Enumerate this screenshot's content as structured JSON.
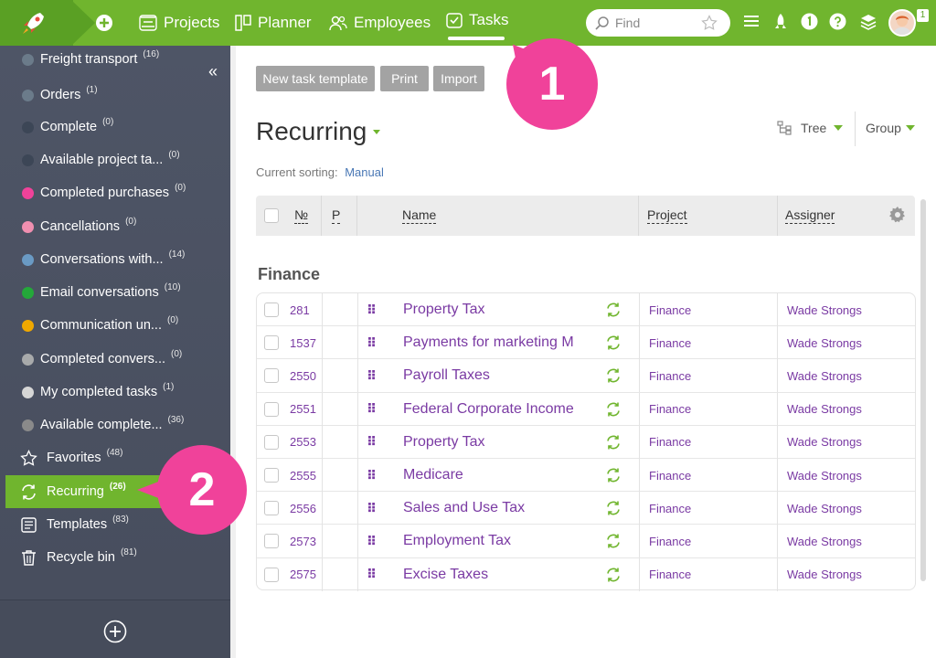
{
  "topbar": {
    "nav": [
      {
        "label": "Projects",
        "icon": "projects-icon"
      },
      {
        "label": "Planner",
        "icon": "planner-icon"
      },
      {
        "label": "Employees",
        "icon": "employees-icon"
      },
      {
        "label": "Tasks",
        "icon": "tasks-icon",
        "active": true
      }
    ],
    "search_placeholder": "Find",
    "avatar_badge": "1"
  },
  "sidebar": {
    "items": [
      {
        "label": "Freight transport",
        "count": "(16)",
        "color": "#6b7b8a"
      },
      {
        "label": "Orders",
        "count": "(1)",
        "color": "#6b7b8a"
      },
      {
        "label": "Complete",
        "count": "(0)",
        "color": "#3c4656"
      },
      {
        "label": "Available project ta...",
        "count": "(0)",
        "color": "#3c4656"
      },
      {
        "label": "Completed purchases",
        "count": "(0)",
        "color": "#f0429a"
      },
      {
        "label": "Cancellations",
        "count": "(0)",
        "color": "#f08fb0"
      },
      {
        "label": "Conversations with...",
        "count": "(14)",
        "color": "#6a9ac4"
      },
      {
        "label": "Email conversations",
        "count": "(10)",
        "color": "#24a83a"
      },
      {
        "label": "Communication un...",
        "count": "(0)",
        "color": "#f0a800"
      },
      {
        "label": "Completed convers...",
        "count": "(0)",
        "color": "#a8aaab"
      },
      {
        "label": "My completed tasks",
        "count": "(1)",
        "color": "#d6d6d6"
      },
      {
        "label": "Available complete...",
        "count": "(36)",
        "color": "#8a8a8a"
      }
    ],
    "special": [
      {
        "label": "Favorites",
        "count": "(48)",
        "icon": "star-icon"
      },
      {
        "label": "Recurring",
        "count": "(26)",
        "icon": "recurring-icon",
        "active": true
      },
      {
        "label": "Templates",
        "count": "(83)",
        "icon": "templates-icon"
      },
      {
        "label": "Recycle bin",
        "count": "(81)",
        "icon": "trash-icon"
      }
    ]
  },
  "toolbar": {
    "new_template": "New task template",
    "print": "Print",
    "import": "Import"
  },
  "page": {
    "title": "Recurring",
    "tree_label": "Tree",
    "group_label": "Group",
    "sorting_label": "Current sorting:",
    "sorting_value": "Manual",
    "section": "Finance"
  },
  "table": {
    "headers": {
      "num": "№",
      "p": "P",
      "name": "Name",
      "project": "Project",
      "assigner": "Assigner"
    },
    "rows": [
      {
        "num": "281",
        "name": "Property Tax",
        "project": "Finance",
        "assigner": "Wade Strongs"
      },
      {
        "num": "1537",
        "name": "Payments for marketing M",
        "project": "Finance",
        "assigner": "Wade Strongs"
      },
      {
        "num": "2550",
        "name": "Payroll Taxes",
        "project": "Finance",
        "assigner": "Wade Strongs"
      },
      {
        "num": "2551",
        "name": "Federal Corporate Income",
        "project": "Finance",
        "assigner": "Wade Strongs"
      },
      {
        "num": "2553",
        "name": "Property Tax",
        "project": "Finance",
        "assigner": "Wade Strongs"
      },
      {
        "num": "2555",
        "name": "Medicare",
        "project": "Finance",
        "assigner": "Wade Strongs"
      },
      {
        "num": "2556",
        "name": "Sales and Use Tax",
        "project": "Finance",
        "assigner": "Wade Strongs"
      },
      {
        "num": "2573",
        "name": "Employment Tax",
        "project": "Finance",
        "assigner": "Wade Strongs"
      },
      {
        "num": "2575",
        "name": "Excise Taxes",
        "project": "Finance",
        "assigner": "Wade Strongs"
      }
    ]
  },
  "callouts": {
    "one": "1",
    "two": "2"
  }
}
